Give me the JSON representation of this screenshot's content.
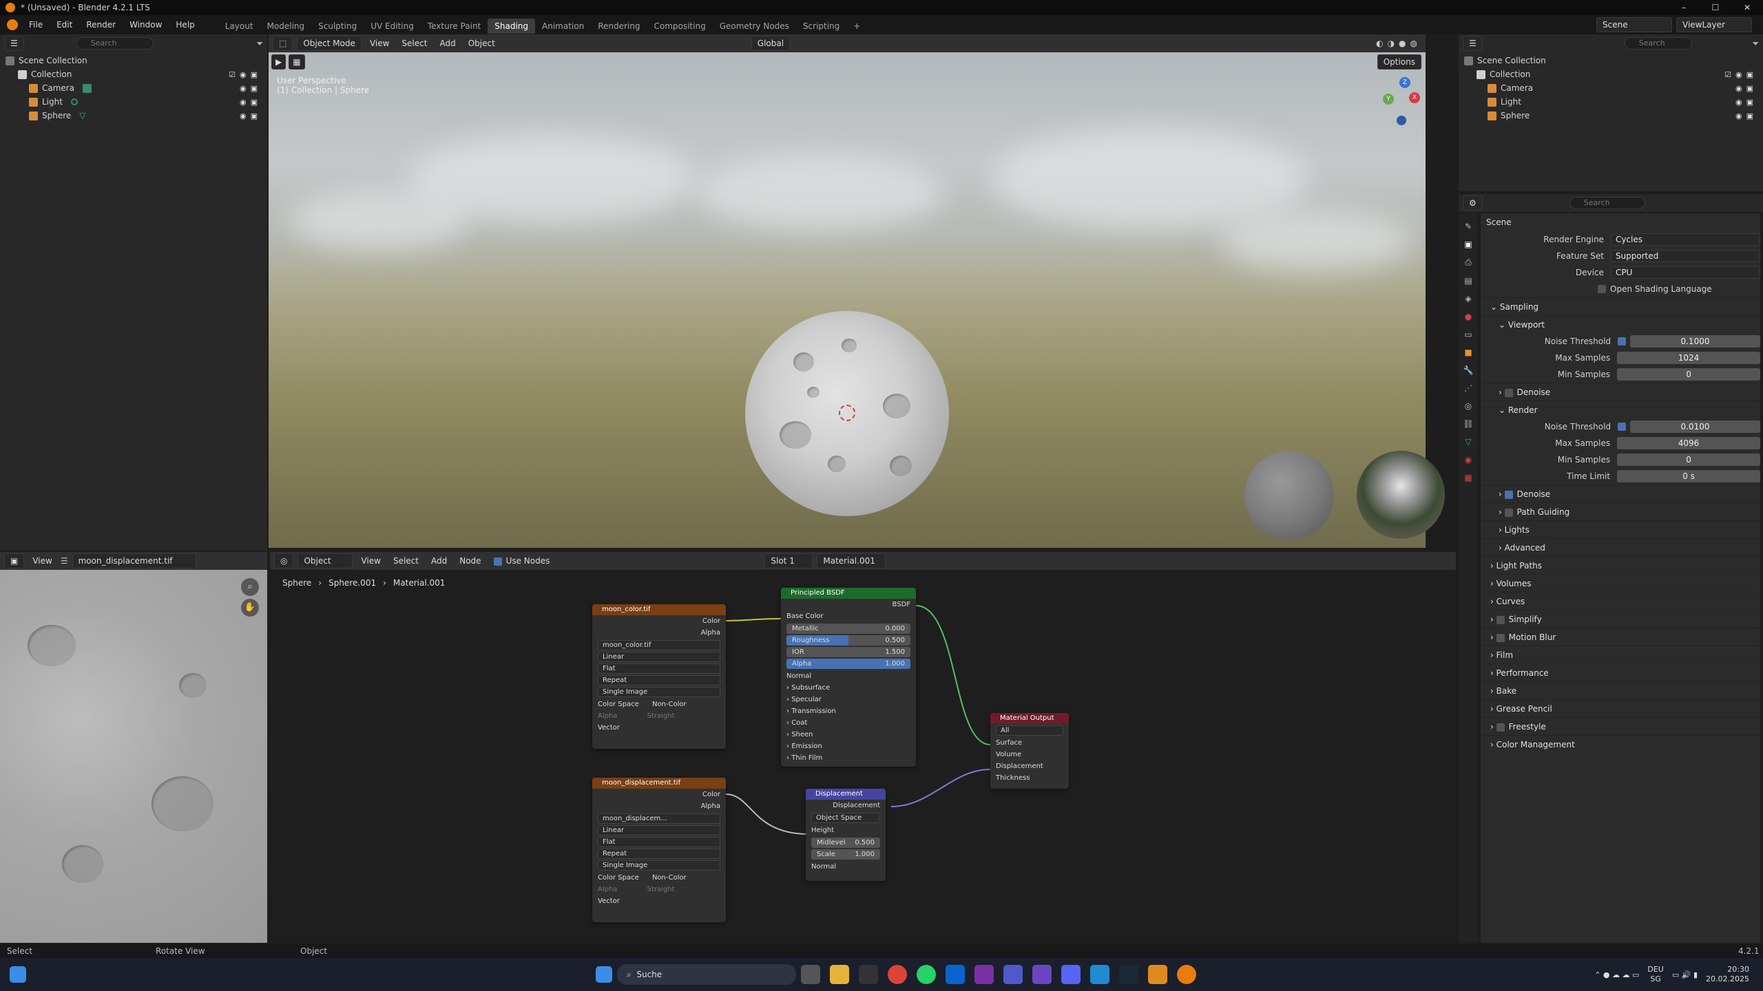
{
  "window": {
    "title": "* (Unsaved) - Blender 4.2.1 LTS",
    "minimize": "–",
    "maximize": "☐",
    "close": "✕"
  },
  "menu": [
    "File",
    "Edit",
    "Render",
    "Window",
    "Help"
  ],
  "workspaces": [
    "Layout",
    "Modeling",
    "Sculpting",
    "UV Editing",
    "Texture Paint",
    "Shading",
    "Animation",
    "Rendering",
    "Compositing",
    "Geometry Nodes",
    "Scripting",
    "+"
  ],
  "active_workspace": "Shading",
  "top_right": {
    "scene": "Scene",
    "view_layer": "ViewLayer"
  },
  "outliner": {
    "search_placeholder": "Search",
    "scene_collection": "Scene Collection",
    "collection": "Collection",
    "items": [
      "Camera",
      "Light",
      "Sphere"
    ]
  },
  "viewport": {
    "mode": "Object Mode",
    "menus": [
      "View",
      "Select",
      "Add",
      "Object"
    ],
    "transform": "Global",
    "options": "Options",
    "overlay_line1": "User Perspective",
    "overlay_line2": "(1) Collection | Sphere",
    "gizmo": {
      "x": "X",
      "y": "Y",
      "z": "Z"
    }
  },
  "image_editor": {
    "view": "View",
    "image_name": "moon_displacement.tif"
  },
  "node_editor": {
    "mode": "Object",
    "menus": [
      "View",
      "Select",
      "Add",
      "Node"
    ],
    "use_nodes": "Use Nodes",
    "slot": "Slot 1",
    "material": "Material.001",
    "breadcrumb": [
      "Sphere",
      "Sphere.001",
      "Material.001"
    ]
  },
  "nodes": {
    "color_tex": {
      "title": "moon_color.tif",
      "out": [
        "Color",
        "Alpha"
      ],
      "image": "moon_color.tif",
      "interp": "Linear",
      "proj": "Flat",
      "ext": "Repeat",
      "src": "Single Image",
      "cs_label": "Color Space",
      "cs": "Non-Color",
      "alpha_label": "Alpha",
      "alpha": "Straight",
      "vector": "Vector"
    },
    "disp_tex": {
      "title": "moon_displacement.tif",
      "out": [
        "Color",
        "Alpha"
      ],
      "image": "moon_displacem...",
      "interp": "Linear",
      "proj": "Flat",
      "ext": "Repeat",
      "src": "Single Image",
      "cs_label": "Color Space",
      "cs": "Non-Color",
      "alpha_label": "Alpha",
      "alpha": "Straight",
      "vector": "Vector"
    },
    "bsdf": {
      "title": "Principled BSDF",
      "out": "BSDF",
      "base_color": "Base Color",
      "metallic": [
        "Metallic",
        "0.000"
      ],
      "roughness": [
        "Roughness",
        "0.500"
      ],
      "ior": [
        "IOR",
        "1.500"
      ],
      "alpha": [
        "Alpha",
        "1.000"
      ],
      "normal": "Normal",
      "panels": [
        "Subsurface",
        "Specular",
        "Transmission",
        "Coat",
        "Sheen",
        "Emission",
        "Thin Film"
      ]
    },
    "displacement": {
      "title": "Displacement",
      "out": "Displacement",
      "space": "Object Space",
      "height": "Height",
      "midlevel": [
        "Midlevel",
        "0.500"
      ],
      "scale": [
        "Scale",
        "1.000"
      ],
      "normal": "Normal"
    },
    "output": {
      "title": "Material Output",
      "target": "All",
      "inputs": [
        "Surface",
        "Volume",
        "Displacement",
        "Thickness"
      ]
    }
  },
  "properties": {
    "search_placeholder": "Search",
    "context": "Scene",
    "render_engine": [
      "Render Engine",
      "Cycles"
    ],
    "feature_set": [
      "Feature Set",
      "Supported"
    ],
    "device": [
      "Device",
      "CPU"
    ],
    "osl": "Open Shading Language",
    "sampling": "Sampling",
    "viewport": "Viewport",
    "vp_noise": [
      "Noise Threshold",
      "0.1000"
    ],
    "vp_max": [
      "Max Samples",
      "1024"
    ],
    "vp_min": [
      "Min Samples",
      "0"
    ],
    "denoise": "Denoise",
    "render": "Render",
    "r_noise": [
      "Noise Threshold",
      "0.0100"
    ],
    "r_max": [
      "Max Samples",
      "4096"
    ],
    "r_min": [
      "Min Samples",
      "0"
    ],
    "r_time": [
      "Time Limit",
      "0 s"
    ],
    "render_denoise": "Denoise",
    "path_guiding": "Path Guiding",
    "lights": "Lights",
    "advanced": "Advanced",
    "sections": [
      "Light Paths",
      "Volumes",
      "Curves",
      "Simplify",
      "Motion Blur",
      "Film",
      "Performance",
      "Bake",
      "Grease Pencil",
      "Freestyle",
      "Color Management"
    ]
  },
  "status": {
    "select": "Select",
    "rotate": "Rotate View",
    "object": "Object",
    "version": "4.2.1"
  },
  "taskbar": {
    "search": "Suche",
    "lang1": "DEU",
    "lang2": "SG",
    "time": "20:30",
    "date": "20.02.2025"
  },
  "colors": {
    "accent": "#4772b3",
    "texture_header": "#7a3f13",
    "bsdf_header": "#1c6b2a",
    "output_header": "#6e1c2c",
    "vector_header": "#4545a0"
  }
}
